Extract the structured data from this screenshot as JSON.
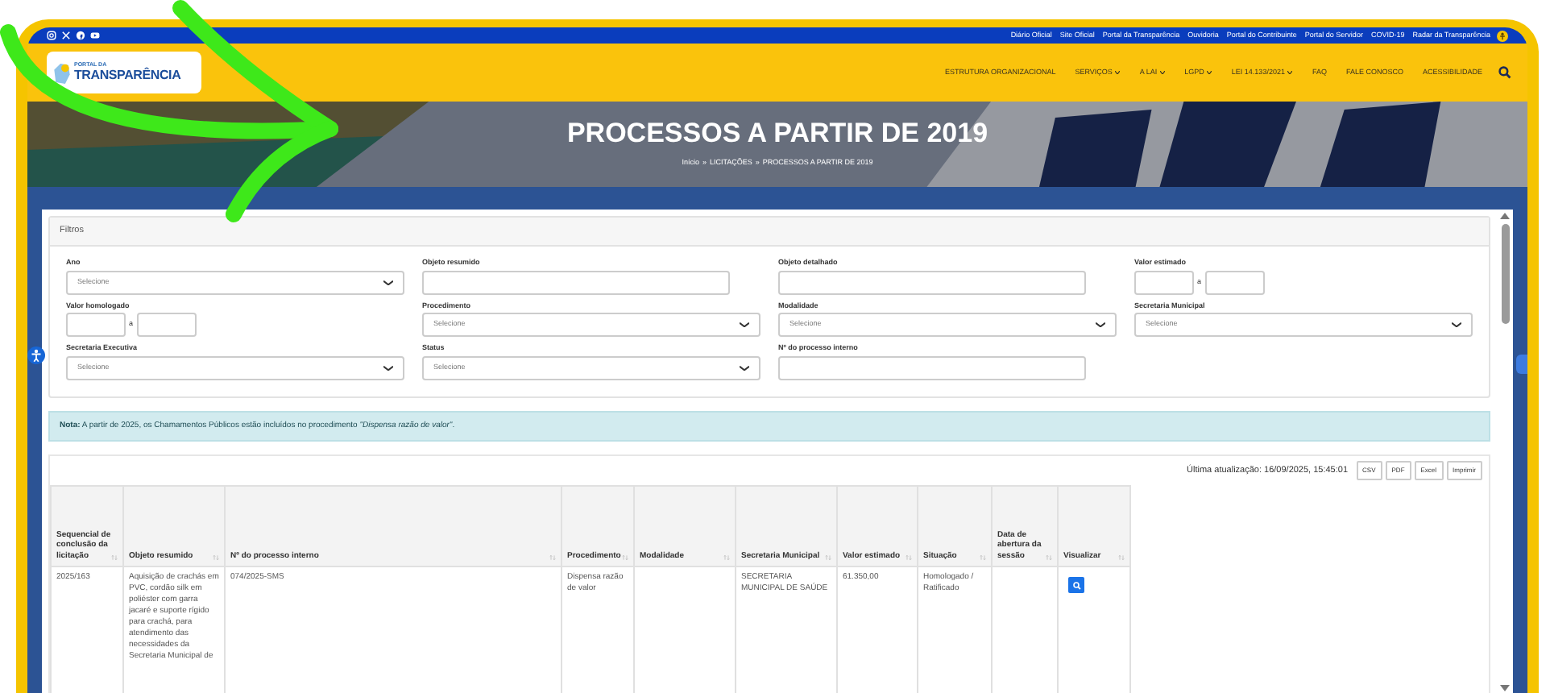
{
  "top_bar": {
    "social": [
      {
        "kind": "instagram"
      },
      {
        "kind": "x"
      },
      {
        "kind": "facebook"
      },
      {
        "kind": "youtube"
      }
    ],
    "links": [
      "Diário Oficial",
      "Site Oficial",
      "Portal da Transparência",
      "Ouvidoria",
      "Portal do Contribuinte",
      "Portal do Servidor",
      "COVID-19",
      "Radar da Transparência"
    ]
  },
  "logo": {
    "line_1": "PORTAL DA",
    "line_2": "TRANSPARÊNCIA"
  },
  "nav": [
    {
      "label": "ESTRUTURA ORGANIZACIONAL",
      "dropdown": false
    },
    {
      "label": "SERVIÇOS",
      "dropdown": true
    },
    {
      "label": "A LAI",
      "dropdown": true
    },
    {
      "label": "LGPD",
      "dropdown": true
    },
    {
      "label": "LEI 14.133/2021",
      "dropdown": true
    },
    {
      "label": "FAQ",
      "dropdown": false
    },
    {
      "label": "FALE CONOSCO",
      "dropdown": false
    },
    {
      "label": "ACESSIBILIDADE",
      "dropdown": false
    }
  ],
  "hero": {
    "title": "PROCESSOS A PARTIR DE 2019",
    "breadcrumb": [
      "Início",
      "LICITAÇÕES",
      "PROCESSOS A PARTIR DE 2019"
    ],
    "breadcrumb_separator": "»"
  },
  "filters": {
    "title": "Filtros",
    "fields": [
      {
        "label": "Ano",
        "kind": "select",
        "placeholder": "Selecione"
      },
      {
        "label": "Objeto resumido",
        "kind": "text"
      },
      {
        "label": "Objeto detalhado",
        "kind": "text"
      },
      {
        "label": "Valor estimado",
        "kind": "range",
        "separator": "a"
      },
      {
        "label": "Valor homologado",
        "kind": "range",
        "separator": "a"
      },
      {
        "label": "Procedimento",
        "kind": "select",
        "placeholder": "Selecione"
      },
      {
        "label": "Modalidade",
        "kind": "select",
        "placeholder": "Selecione"
      },
      {
        "label": "Secretaria Municipal",
        "kind": "select",
        "placeholder": "Selecione"
      },
      {
        "label": "Secretaria Executiva",
        "kind": "select",
        "placeholder": "Selecione"
      },
      {
        "label": "Status",
        "kind": "select",
        "placeholder": "Selecione"
      },
      {
        "label": "Nº do processo interno",
        "kind": "text"
      }
    ]
  },
  "note": "**Nota:** A partir de 2025, os Chamamentos Públicos estão incluídos no procedimento *\"Dispensa razão de valor\"*.",
  "last_update": "Última atualização: 16/09/2025, 15:45:01",
  "export_buttons": [
    "CSV",
    "PDF",
    "Excel",
    "Imprimir"
  ],
  "table": {
    "columns": [
      "Sequencial de conclusão da licitação",
      "Objeto resumido",
      "Nº do processo interno",
      "Procedimento",
      "Modalidade",
      "Secretaria Municipal",
      "Valor estimado",
      "Situação",
      "Data de abertura da sessão",
      "Visualizar"
    ],
    "rows": [
      {
        "cells": [
          "2025/163",
          "Aquisição de crachás em PVC, cordão silk em poliéster com garra jacaré e suporte rígido para crachá, para atendimento das necessidades da Secretaria Municipal de",
          "074/2025-SMS",
          "Dispensa razão de valor",
          "",
          "SECRETARIA MUNICIPAL DE SAÚDE",
          "61.350,00",
          "Homologado / Ratificado",
          ""
        ],
        "view_button": true
      }
    ]
  }
}
